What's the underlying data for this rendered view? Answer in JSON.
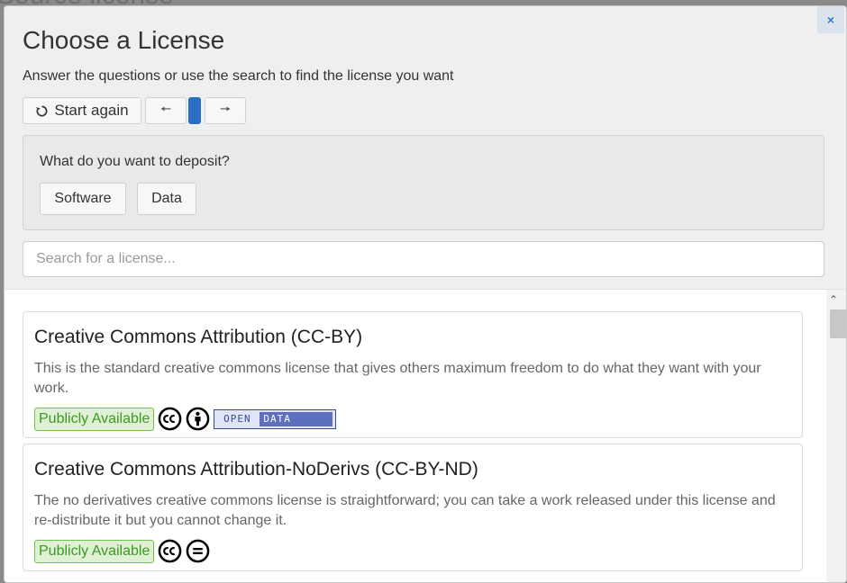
{
  "background": {
    "title": "Source license"
  },
  "modal": {
    "close_label": "×",
    "title": "Choose a License",
    "subtitle": "Answer the questions or use the search to find the license you want"
  },
  "wizard": {
    "start_again_label": "Start again",
    "prev_label": "🠔",
    "next_label": "🠖"
  },
  "question": {
    "text": "What do you want to deposit?",
    "options": [
      "Software",
      "Data"
    ]
  },
  "search": {
    "placeholder": "Search for a license..."
  },
  "licenses": [
    {
      "title": "Creative Commons Attribution (CC-BY)",
      "description": "This is the standard creative commons license that gives others maximum freedom to do what they want with your work.",
      "badge": "Publicly Available",
      "icons": [
        "cc-icon",
        "attribution-icon",
        "open-data-badge"
      ],
      "open_data_left": "OPEN",
      "open_data_right": "DATA"
    },
    {
      "title": "Creative Commons Attribution-NoDerivs (CC-BY-ND)",
      "description": "The no derivatives creative commons license is straightforward; you can take a work released under this license and re-distribute it but you cannot change it.",
      "badge": "Publicly Available",
      "icons": [
        "cc-icon",
        "no-derivatives-icon"
      ]
    }
  ],
  "colors": {
    "accent": "#2a6fc4",
    "badge_green": "#3c9a24",
    "badge_bg": "#dff0d4"
  }
}
